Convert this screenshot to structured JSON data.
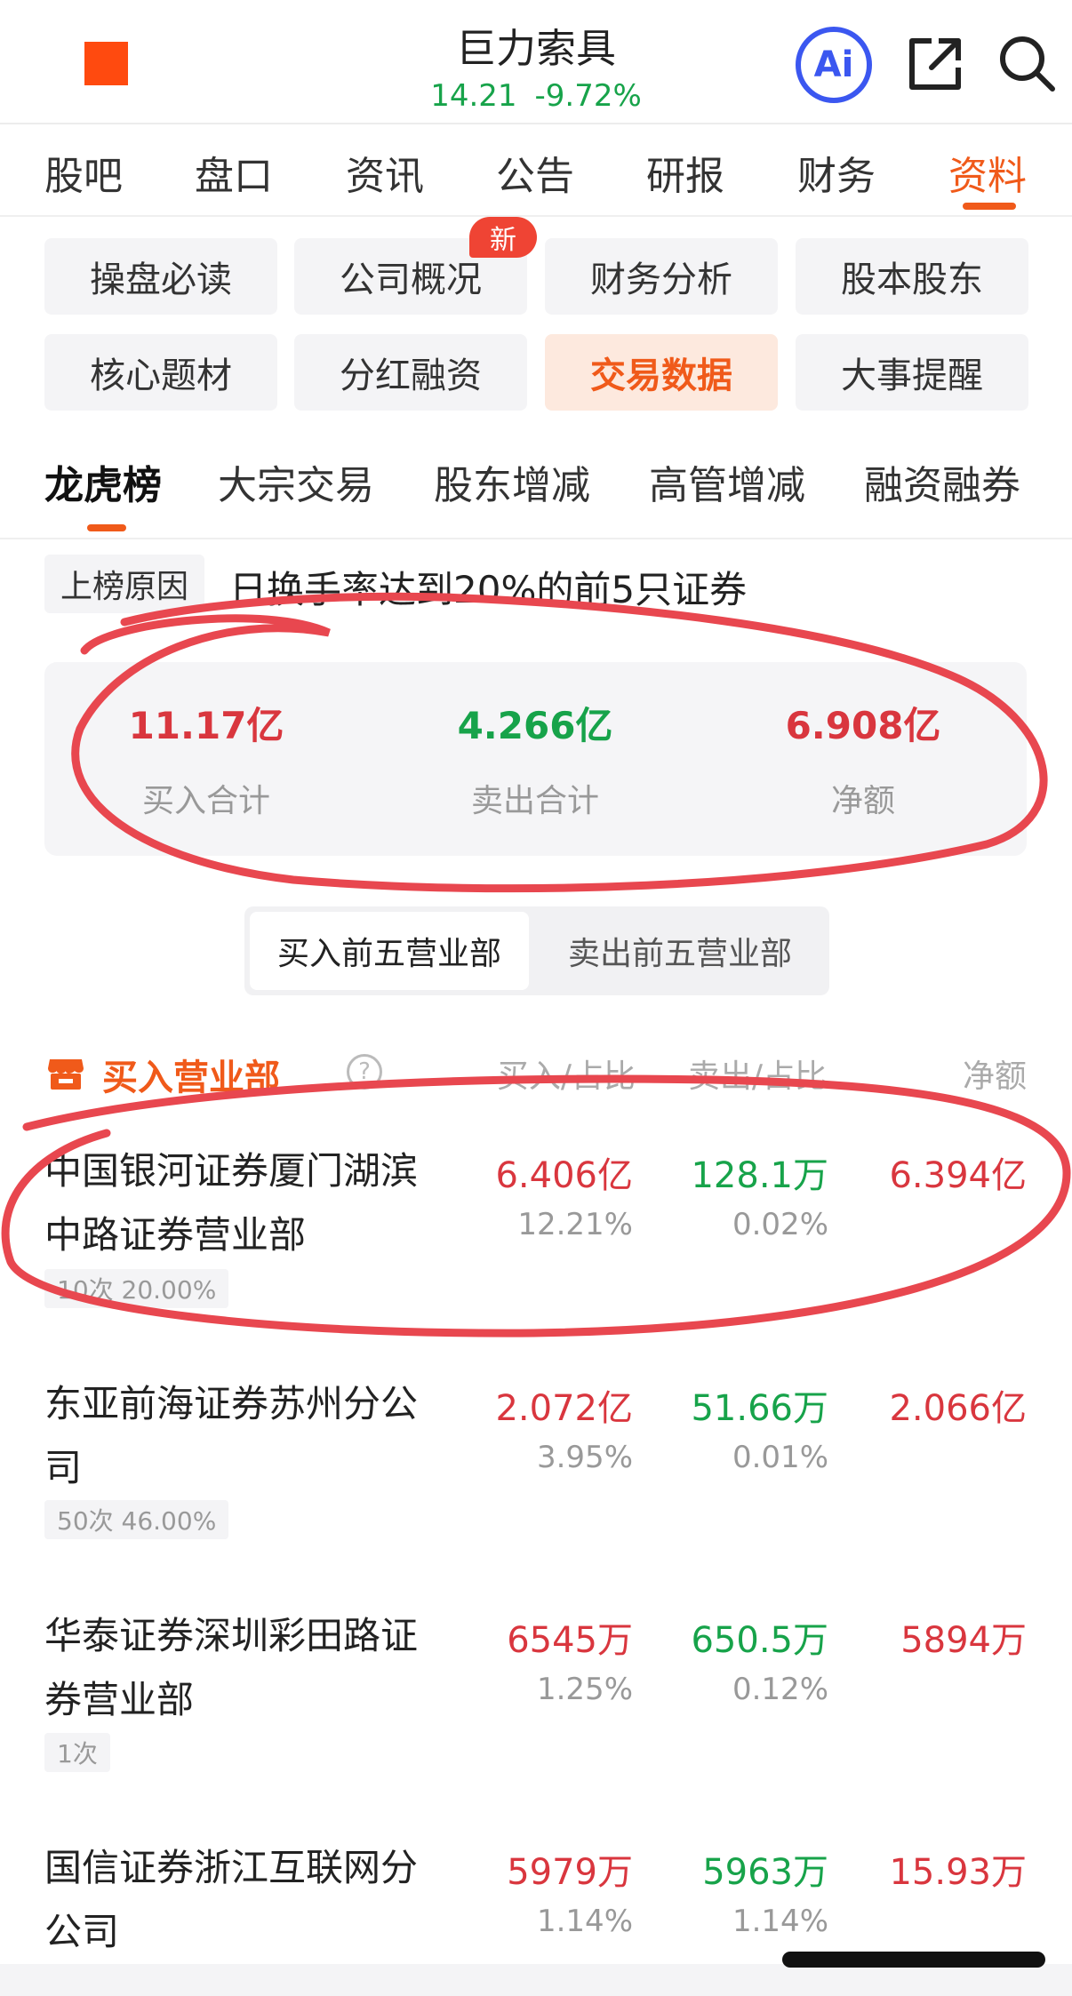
{
  "header": {
    "title": "巨力索具",
    "price": "14.21",
    "change": "-9.72%",
    "ai_label": "Ai"
  },
  "main_tabs": [
    "股吧",
    "盘口",
    "资讯",
    "公告",
    "研报",
    "财务",
    "资料"
  ],
  "active_main_tab": "资料",
  "sub_chips": [
    "操盘必读",
    "公司概况",
    "财务分析",
    "股本股东",
    "核心题材",
    "分红融资",
    "交易数据",
    "大事提醒"
  ],
  "new_badge": "新",
  "section_tabs": [
    "龙虎榜",
    "大宗交易",
    "股东增减",
    "高管增减",
    "融资融券"
  ],
  "reason": {
    "label": "上榜原因",
    "text": "日换手率达到20%的前5只证券"
  },
  "summary": {
    "buy_total": "11.17亿",
    "buy_label": "买入合计",
    "sell_total": "4.266亿",
    "sell_label": "卖出合计",
    "net": "6.908亿",
    "net_label": "净额"
  },
  "toggle": {
    "buy_top5": "买入前五营业部",
    "sell_top5": "卖出前五营业部"
  },
  "table": {
    "title": "买入营业部",
    "help": "?",
    "col_buy": "买入/占比",
    "col_sell": "卖出/占比",
    "col_net": "净额",
    "rows": [
      {
        "name": "中国银河证券厦门湖滨中路证券营业部",
        "badge": "10次  20.00%",
        "buy": "6.406亿",
        "buy_pct": "12.21%",
        "sell": "128.1万",
        "sell_pct": "0.02%",
        "net": "6.394亿"
      },
      {
        "name": "东亚前海证券苏州分公司",
        "badge": "50次  46.00%",
        "buy": "2.072亿",
        "buy_pct": "3.95%",
        "sell": "51.66万",
        "sell_pct": "0.01%",
        "net": "2.066亿"
      },
      {
        "name": "华泰证券深圳彩田路证券营业部",
        "badge": "1次",
        "buy": "6545万",
        "buy_pct": "1.25%",
        "sell": "650.5万",
        "sell_pct": "0.12%",
        "net": "5894万"
      },
      {
        "name": "国信证券浙江互联网分公司",
        "badge": "",
        "buy": "5979万",
        "buy_pct": "1.14%",
        "sell": "5963万",
        "sell_pct": "1.14%",
        "net": "15.93万"
      }
    ]
  },
  "colors": {
    "accent": "#f05a1a",
    "up_red": "#d9363e",
    "down_green": "#17a34a",
    "annotation_red": "#e8474f"
  }
}
